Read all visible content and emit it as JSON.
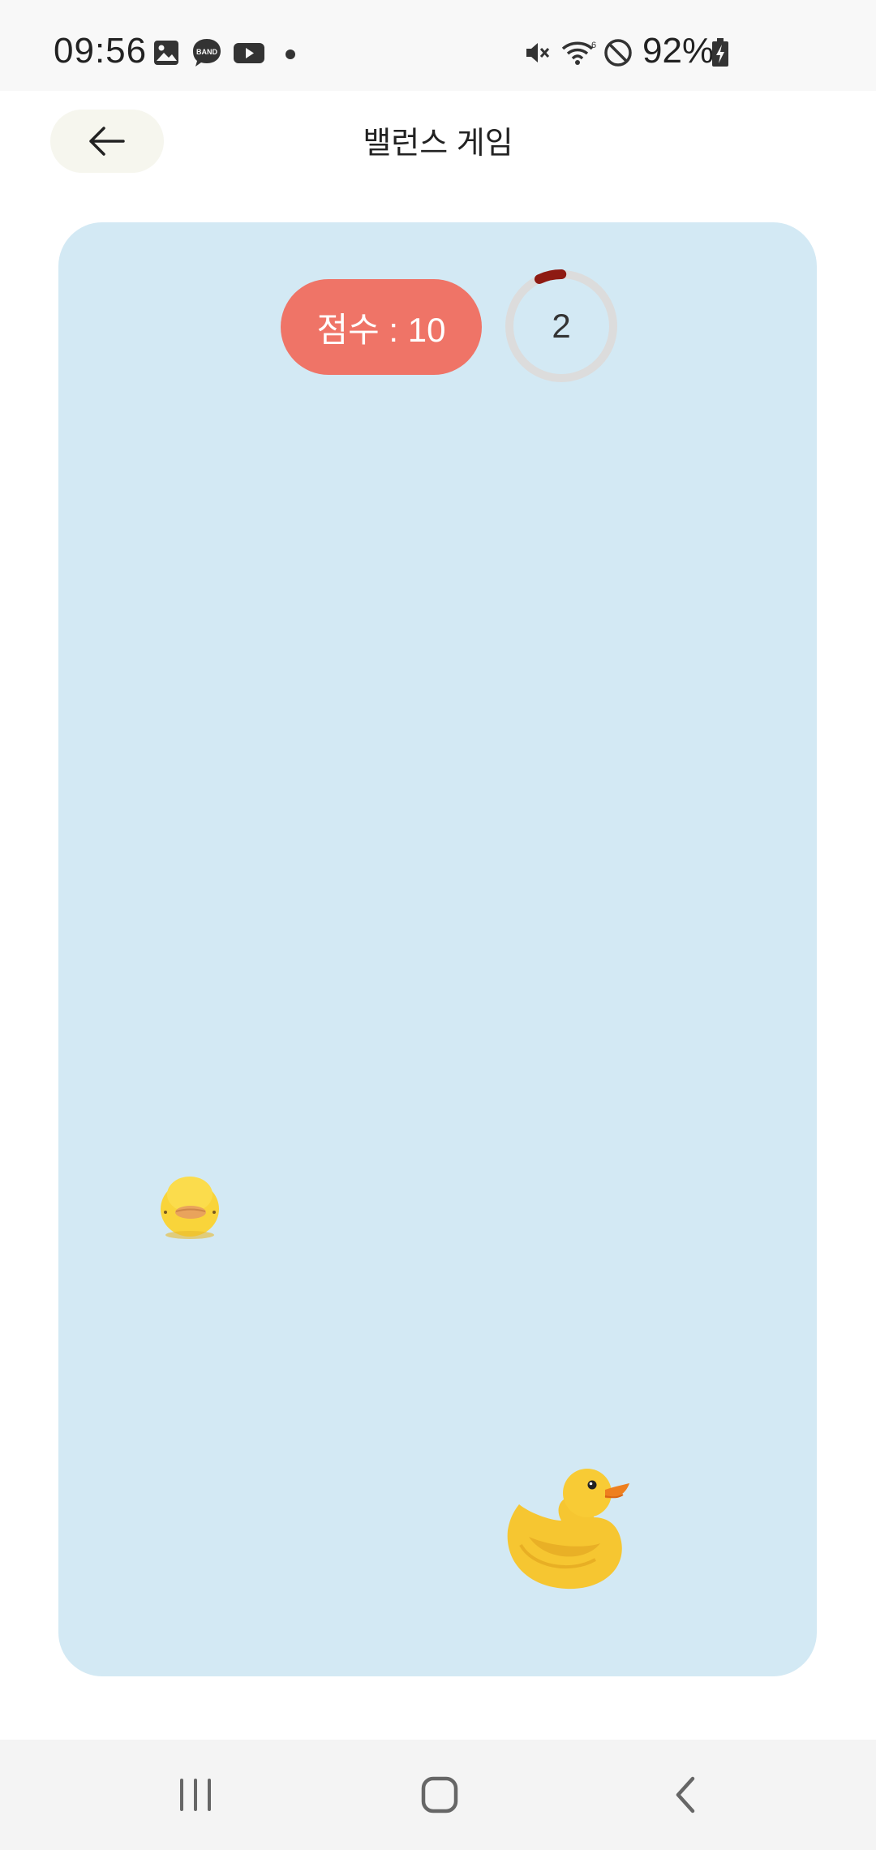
{
  "status_bar": {
    "time": "09:56",
    "battery_percent": "92%",
    "notification_icons": [
      "gallery-icon",
      "band-icon",
      "youtube-icon",
      "more-dot"
    ],
    "system_icons": [
      "mute-icon",
      "wifi-icon",
      "do-not-disturb-icon",
      "battery-charging-icon"
    ],
    "band_label": "BAND"
  },
  "app_bar": {
    "title": "밸런스 게임",
    "back_icon": "arrow-left-icon"
  },
  "game": {
    "score_label": "점수 : 10",
    "timer_value": "2",
    "timer_progress_fraction": 0.07,
    "colors": {
      "background": "#d3e9f4",
      "score_pill": "#ef7467",
      "timer_track": "#dcdcdc",
      "timer_arc": "#8e1a12"
    },
    "sprites": [
      "chick-icon",
      "rubber-duck-icon"
    ]
  },
  "nav_bar": {
    "buttons": [
      "recent-apps-icon",
      "home-icon",
      "back-icon"
    ]
  }
}
